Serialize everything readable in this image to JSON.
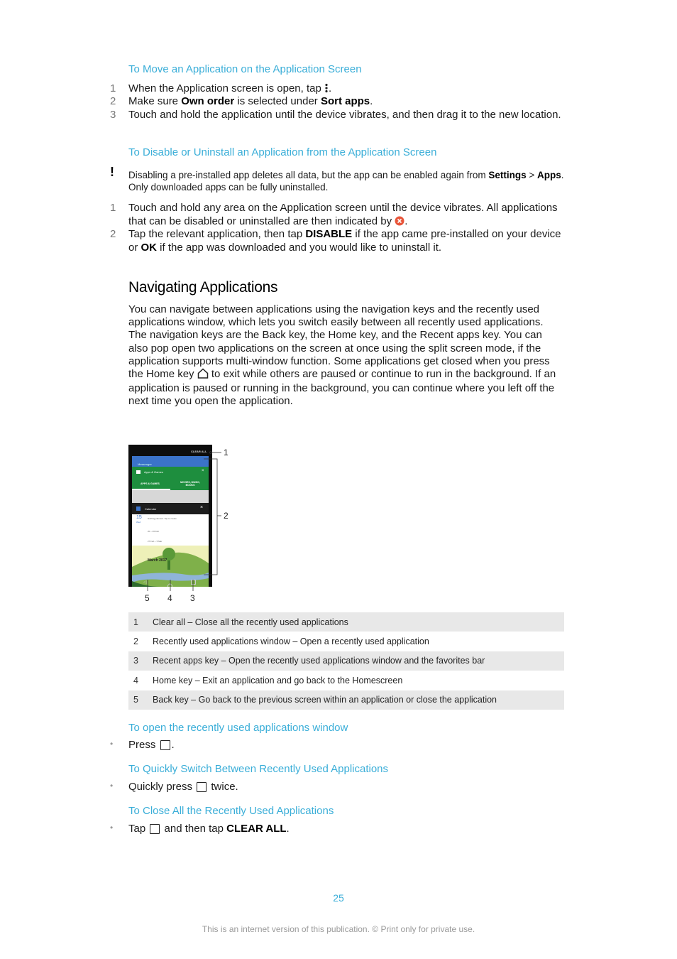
{
  "section1": {
    "title": "To Move an Application on the Application Screen",
    "steps": [
      {
        "num": "1",
        "pre": "When the Application screen is open, tap ",
        "icon": "more-vertical-icon",
        "post": "."
      },
      {
        "num": "2",
        "pre": "Make sure ",
        "b1": "Own order",
        "mid": " is selected under ",
        "b2": "Sort apps",
        "post": "."
      },
      {
        "num": "3",
        "text": "Touch and hold the application until the device vibrates, and then drag it to the new location."
      }
    ]
  },
  "section2": {
    "title": "To Disable or Uninstall an Application from the Application Screen",
    "note": {
      "icon": "exclamation-icon",
      "pre": "Disabling a pre-installed app deletes all data, but the app can be enabled again from ",
      "b1": "Settings",
      "mid": " > ",
      "b2": "Apps",
      "post": ". Only downloaded apps can be fully uninstalled."
    },
    "steps": [
      {
        "num": "1",
        "pre": "Touch and hold any area on the Application screen until the device vibrates. All applications that can be disabled or uninstalled are then indicated by ",
        "icon": "remove-badge-icon",
        "post": "."
      },
      {
        "num": "2",
        "pre": "Tap the relevant application, then tap ",
        "b1": "DISABLE",
        "mid": " if the app came pre-installed on your device or ",
        "b2": "OK",
        "post": " if the app was downloaded and you would like to uninstall it."
      }
    ]
  },
  "navigating": {
    "heading": "Navigating Applications",
    "para_pre": "You can navigate between applications using the navigation keys and the recently used applications window, which lets you switch easily between all recently used applications. The navigation keys are the Back key, the Home key, and the Recent apps key. You can also pop open two applications on the screen at once using the split screen mode, if the application supports multi-window function. Some applications get closed when you press the Home key ",
    "para_post": " to exit while others are paused or continue to run in the background. If an application is paused or running in the background, you can continue where you left off the next time you open the application."
  },
  "phone": {
    "clear_all": "CLEAR ALL",
    "card_top_title": "Messenger",
    "card_apps_title": "Apps & Games",
    "tab1": "APPS & GAMES",
    "tab2": "MOVIES, MUSIC, BOOKS",
    "calendar_title": "Calendar",
    "cal_day": "15",
    "cal_weekday": "Wed",
    "cal_nothing": "Nothing planned. Tap to create.",
    "cal_range1": "20 – 26 Feb",
    "cal_range2": "27 Feb – 5 Mar",
    "cal_month": "March 2017",
    "colors": {
      "blue": "#3b73c9",
      "green": "#1e8e3e",
      "bg": "#0d0d0d"
    }
  },
  "callouts": [
    "1",
    "2",
    "3",
    "4",
    "5"
  ],
  "legend": [
    {
      "num": "1",
      "text": "Clear all – Close all the recently used applications"
    },
    {
      "num": "2",
      "text": "Recently used applications window – Open a recently used application"
    },
    {
      "num": "3",
      "text": "Recent apps key – Open the recently used applications window and the favorites bar"
    },
    {
      "num": "4",
      "text": "Home key – Exit an application and go back to the Homescreen"
    },
    {
      "num": "5",
      "text": "Back key – Go back to the previous screen within an application or close the application"
    }
  ],
  "open_recent": {
    "title": "To open the recently used applications window",
    "pre": "Press ",
    "icon": "recent-apps-icon",
    "post": "."
  },
  "quick_switch": {
    "title": "To Quickly Switch Between Recently Used Applications",
    "pre": "Quickly press ",
    "icon": "recent-apps-icon",
    "post": " twice."
  },
  "close_all": {
    "title": "To Close All the Recently Used Applications",
    "pre": "Tap ",
    "icon": "recent-apps-icon",
    "mid": " and then tap ",
    "b1": "CLEAR ALL",
    "post": "."
  },
  "page_number": "25",
  "footer": "This is an internet version of this publication. © Print only for private use.",
  "colors": {
    "accent": "#3aaed8",
    "text": "#1a1a1a",
    "badge": "#e8553a",
    "table_shade": "#e8e8e8"
  }
}
